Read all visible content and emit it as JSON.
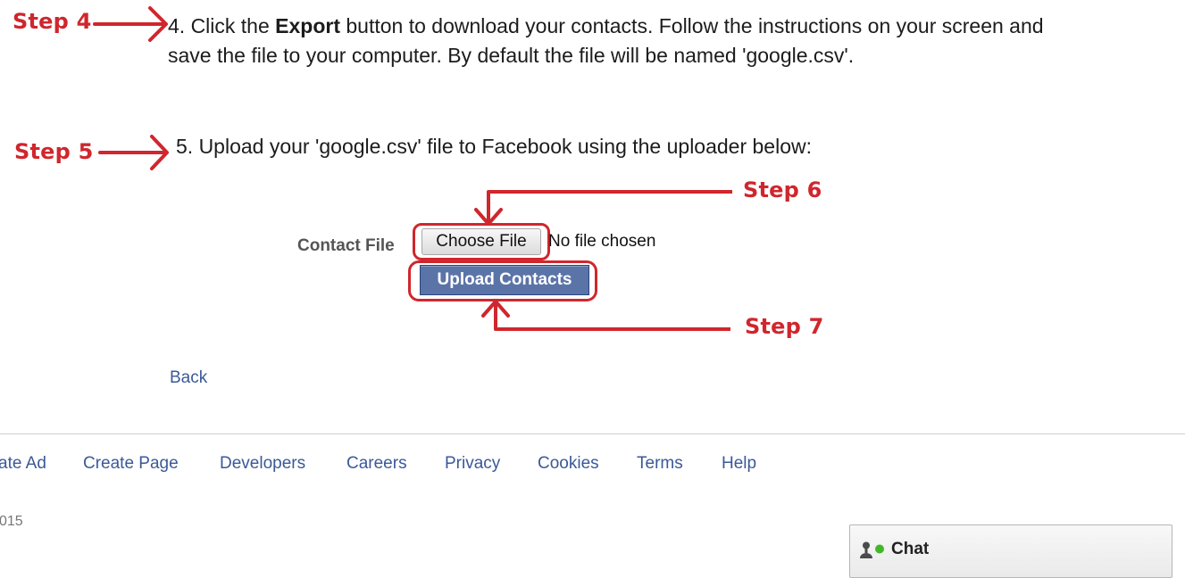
{
  "instructions": {
    "step4_pre": "4. Click the ",
    "step4_bold": "Export",
    "step4_post": " button to download your contacts. Follow the instructions on your screen and",
    "step4_line2": "save the file to your computer. By default the file will be named 'google.csv'.",
    "step5": "5. Upload your 'google.csv' file to Facebook using the uploader below:"
  },
  "annotations": {
    "step4": "Step 4",
    "step5": "Step 5",
    "step6": "Step 6",
    "step7": "Step 7",
    "color": "#d0262d"
  },
  "form": {
    "label": "Contact File",
    "choose_file": "Choose File",
    "no_file": "No file chosen",
    "upload": "Upload Contacts"
  },
  "back_link": "Back",
  "footer": {
    "links": [
      "ate Ad",
      "Create Page",
      "Developers",
      "Careers",
      "Privacy",
      "Cookies",
      "Terms",
      "Help"
    ],
    "copyright": "015"
  },
  "chat": {
    "label": "Chat",
    "icon": "person-online-icon"
  },
  "colors": {
    "link": "#3b5998",
    "button": "#5b74a8"
  }
}
